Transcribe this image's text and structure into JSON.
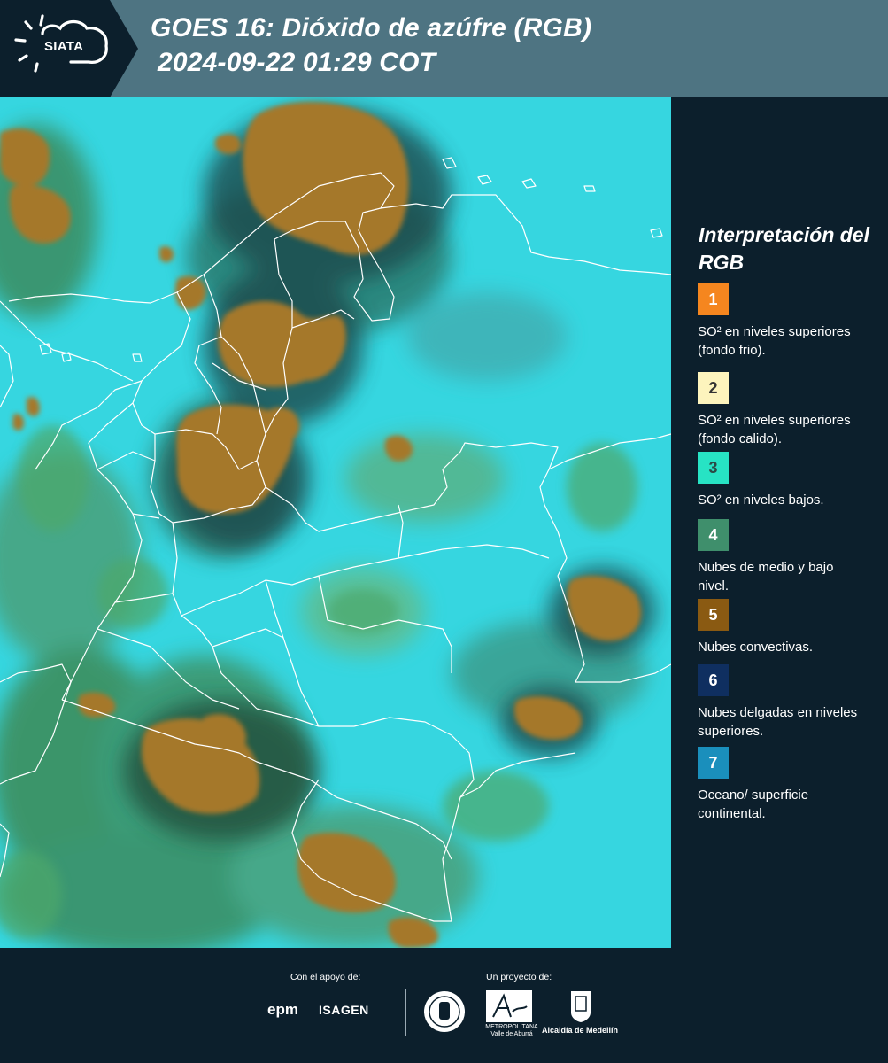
{
  "header": {
    "logo_text": "SIATA",
    "title_line1": "GOES 16: Dióxido de azúfre (RGB)",
    "title_line2": "2024-09-22 01:29 COT",
    "background_color": "#4e7482",
    "logo_background_color": "#0c1f2c"
  },
  "legend": {
    "title": "Interpretación del RGB",
    "items": [
      {
        "number": "1",
        "label": "SO² en niveles superiores (fondo frio).",
        "color": "#f5861f",
        "text_color": "#ffffff"
      },
      {
        "number": "2",
        "label": "SO² en niveles superiores (fondo calido).",
        "color": "#fdf4bd",
        "text_color": "#333333"
      },
      {
        "number": "3",
        "label": "SO² en niveles bajos.",
        "color": "#27e3c4",
        "text_color": "#2b4a45"
      },
      {
        "number": "4",
        "label": "Nubes de medio y bajo nivel.",
        "color": "#3f8f6c",
        "text_color": "#ffffff"
      },
      {
        "number": "5",
        "label": "Nubes convectivas.",
        "color": "#8a5a12",
        "text_color": "#ffffff"
      },
      {
        "number": "6",
        "label": "Nubes delgadas en niveles superiores.",
        "color": "#0f2f60",
        "text_color": "#ffffff"
      },
      {
        "number": "7",
        "label": "Oceano/ superficie continental.",
        "color": "#1a8fbc",
        "text_color": "#ffffff"
      }
    ]
  },
  "footer": {
    "support_caption": "Con el apoyo de:",
    "project_caption": "Un proyecto de:",
    "sponsor_1": "epm",
    "sponsor_2": "ISAGEN",
    "partner_1_text": "METROPOLITANA Valle de Aburrá",
    "partner_2_text": "Alcaldía de Medellín"
  },
  "map": {
    "background_color": "#2fd3df",
    "convective_color": "#a5782a",
    "low_cloud_color": "#3c8a57",
    "border_color": "#ffffff"
  }
}
